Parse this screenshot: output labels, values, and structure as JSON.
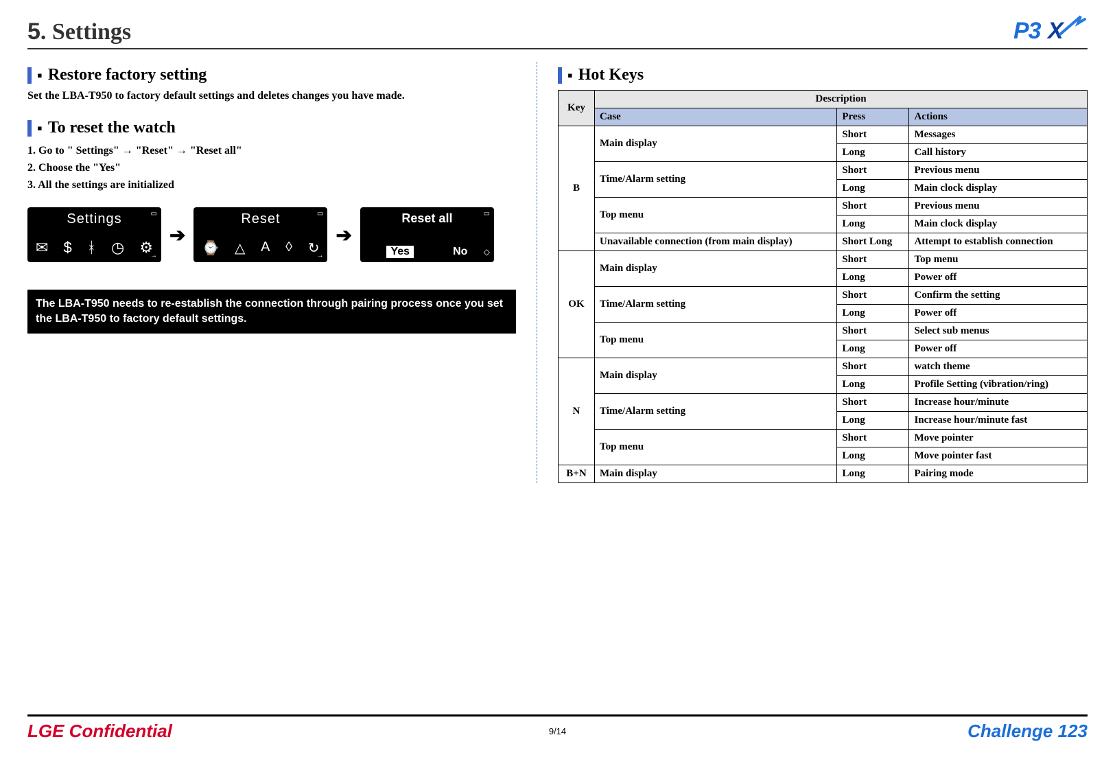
{
  "header": {
    "chapter_num": "5",
    "title_rest": ". Settings",
    "logo_text": "P3X"
  },
  "left": {
    "restore": {
      "heading": "Restore factory setting",
      "body": "Set the LBA-T950 to factory default settings and deletes changes you have made."
    },
    "reset": {
      "heading": "To reset the watch",
      "step1_prefix": "1. Go to \" Settings\" ",
      "step1_mid1": " \"Reset\" ",
      "step1_mid2": " \"Reset all\"",
      "step2": "2. Choose the \"Yes\"",
      "step3": "3. All the settings are initialized",
      "arrow": "→"
    },
    "screens": {
      "s1_title": "Settings",
      "s2_title": "Reset",
      "s3_title": "Reset  all",
      "yes": "Yes",
      "no": "No",
      "step_arrow": "➔"
    },
    "note": "The LBA-T950 needs to re-establish the connection through pairing process once you set the LBA-T950 to factory default settings."
  },
  "right": {
    "heading": "Hot Keys",
    "headers": {
      "key": "Key",
      "description": "Description",
      "case": "Case",
      "press": "Press",
      "actions": "Actions"
    },
    "rows": [
      {
        "key": "B",
        "newkey": true,
        "keyspan": 7,
        "case": "Main display",
        "casespan": 2,
        "press": "Short",
        "action": "Messages"
      },
      {
        "key": "",
        "newkey": false,
        "keyspan": 0,
        "case": "",
        "casespan": 0,
        "press": "Long",
        "action": "Call history"
      },
      {
        "key": "",
        "newkey": false,
        "keyspan": 0,
        "case": "Time/Alarm setting",
        "casespan": 2,
        "press": "Short",
        "action": "Previous menu"
      },
      {
        "key": "",
        "newkey": false,
        "keyspan": 0,
        "case": "",
        "casespan": 0,
        "press": "Long",
        "action": "Main clock display"
      },
      {
        "key": "",
        "newkey": false,
        "keyspan": 0,
        "case": "Top menu",
        "casespan": 2,
        "press": "Short",
        "action": "Previous menu"
      },
      {
        "key": "",
        "newkey": false,
        "keyspan": 0,
        "case": "",
        "casespan": 0,
        "press": "Long",
        "action": "Main clock display"
      },
      {
        "key": "",
        "newkey": false,
        "keyspan": 0,
        "case": "Unavailable connection (from main display)",
        "casespan": 1,
        "press": "Short Long",
        "action": "Attempt to establish connection"
      },
      {
        "key": "OK",
        "newkey": true,
        "keyspan": 6,
        "case": "Main display",
        "casespan": 2,
        "press": "Short",
        "action": "Top menu"
      },
      {
        "key": "",
        "newkey": false,
        "keyspan": 0,
        "case": "",
        "casespan": 0,
        "press": "Long",
        "action": "Power off"
      },
      {
        "key": "",
        "newkey": false,
        "keyspan": 0,
        "case": "Time/Alarm setting",
        "casespan": 2,
        "press": "Short",
        "action": "Confirm the setting"
      },
      {
        "key": "",
        "newkey": false,
        "keyspan": 0,
        "case": "",
        "casespan": 0,
        "press": "Long",
        "action": "Power off"
      },
      {
        "key": "",
        "newkey": false,
        "keyspan": 0,
        "case": "Top menu",
        "casespan": 2,
        "press": "Short",
        "action": "Select sub menus"
      },
      {
        "key": "",
        "newkey": false,
        "keyspan": 0,
        "case": "",
        "casespan": 0,
        "press": "Long",
        "action": "Power off"
      },
      {
        "key": "N",
        "newkey": true,
        "keyspan": 6,
        "case": "Main display",
        "casespan": 2,
        "press": "Short",
        "action": " watch theme"
      },
      {
        "key": "",
        "newkey": false,
        "keyspan": 0,
        "case": "",
        "casespan": 0,
        "press": "Long",
        "action": "Profile Setting (vibration/ring)"
      },
      {
        "key": "",
        "newkey": false,
        "keyspan": 0,
        "case": "Time/Alarm setting",
        "casespan": 2,
        "press": "Short",
        "action": "Increase hour/minute"
      },
      {
        "key": "",
        "newkey": false,
        "keyspan": 0,
        "case": "",
        "casespan": 0,
        "press": "Long",
        "action": "Increase hour/minute fast"
      },
      {
        "key": "",
        "newkey": false,
        "keyspan": 0,
        "case": "Top menu",
        "casespan": 2,
        "press": "Short",
        "action": "Move pointer"
      },
      {
        "key": "",
        "newkey": false,
        "keyspan": 0,
        "case": "",
        "casespan": 0,
        "press": "Long",
        "action": "Move pointer fast"
      },
      {
        "key": "B+N",
        "newkey": true,
        "keyspan": 1,
        "case": "Main display",
        "casespan": 1,
        "press": "Long",
        "action": "Pairing mode"
      }
    ]
  },
  "footer": {
    "left": "LGE Confidential",
    "center": "9/14",
    "right": "Challenge 123"
  }
}
